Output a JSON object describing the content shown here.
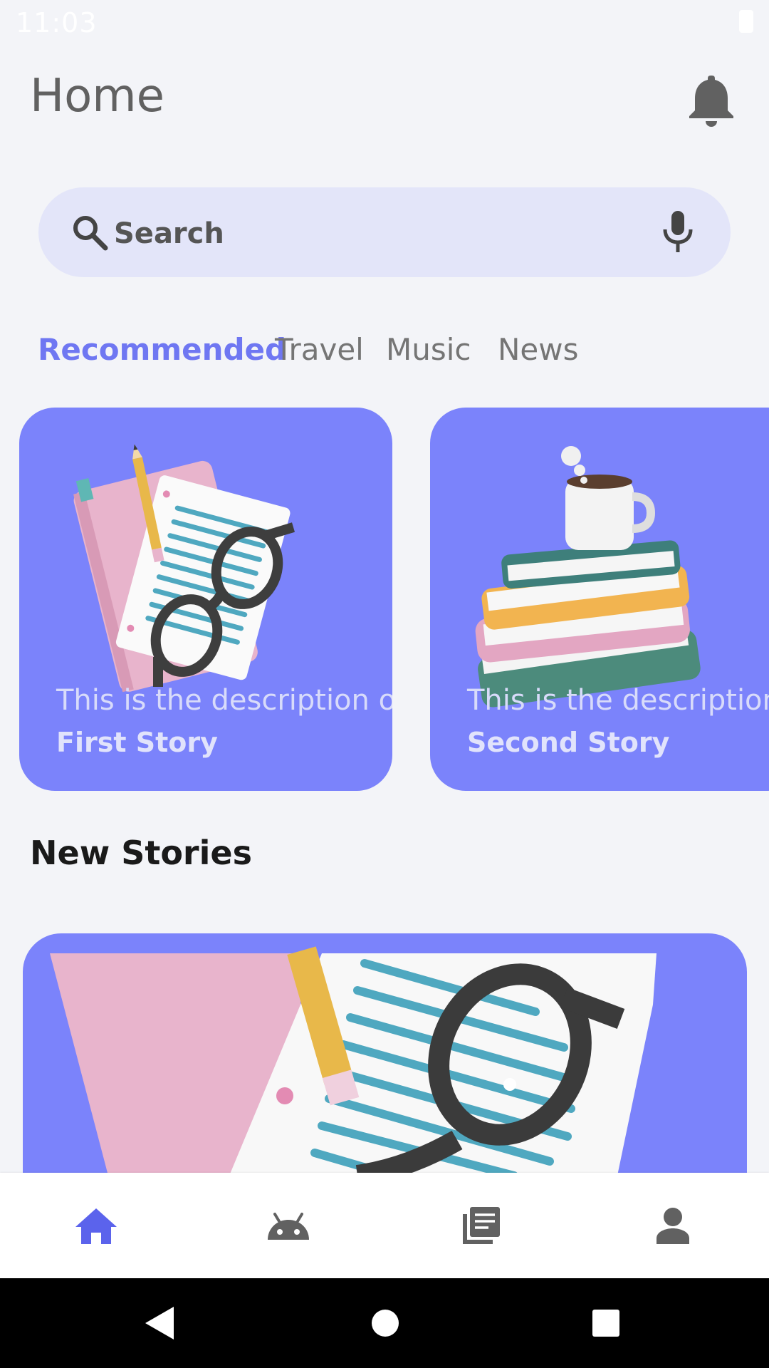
{
  "status_bar": {
    "time": "11:03"
  },
  "header": {
    "title": "Home"
  },
  "search": {
    "placeholder": "Search"
  },
  "tabs": [
    {
      "label": "Recommended",
      "active": true
    },
    {
      "label": "Travel",
      "active": false
    },
    {
      "label": "Music",
      "active": false
    },
    {
      "label": "News",
      "active": false
    }
  ],
  "stories": [
    {
      "description": "This is the description of",
      "title": "First Story"
    },
    {
      "description": "This is the description",
      "title": "Second Story"
    }
  ],
  "new_stories": {
    "heading": "New Stories"
  },
  "bottom_nav": [
    {
      "icon": "home-icon",
      "active": true
    },
    {
      "icon": "android-icon",
      "active": false
    },
    {
      "icon": "library-icon",
      "active": false
    },
    {
      "icon": "person-icon",
      "active": false
    }
  ],
  "colors": {
    "accent": "#6F77F2",
    "card_background": "#7B83FB",
    "search_background": "#E3E5F9",
    "page_background": "#F3F4F8"
  }
}
